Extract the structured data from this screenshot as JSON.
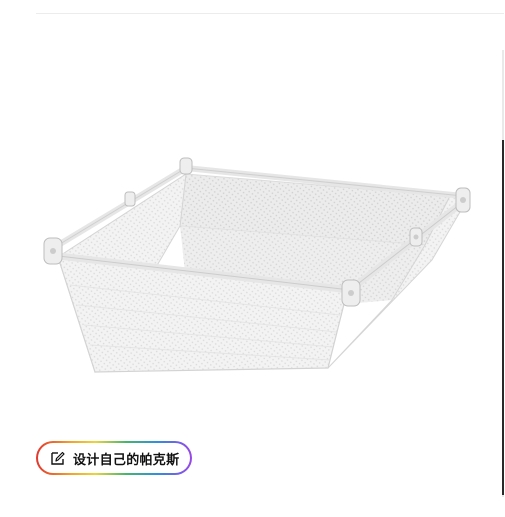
{
  "product": {
    "image_icon": "wire-mesh-basket-product-image"
  },
  "design_button": {
    "label": "设计自己的帕克斯",
    "icon": "pen-edit-icon",
    "gradient_colors": [
      "#e2352f",
      "#f2a12b",
      "#e9d53a",
      "#43b66b",
      "#2f8fe0",
      "#9a45e8"
    ]
  }
}
